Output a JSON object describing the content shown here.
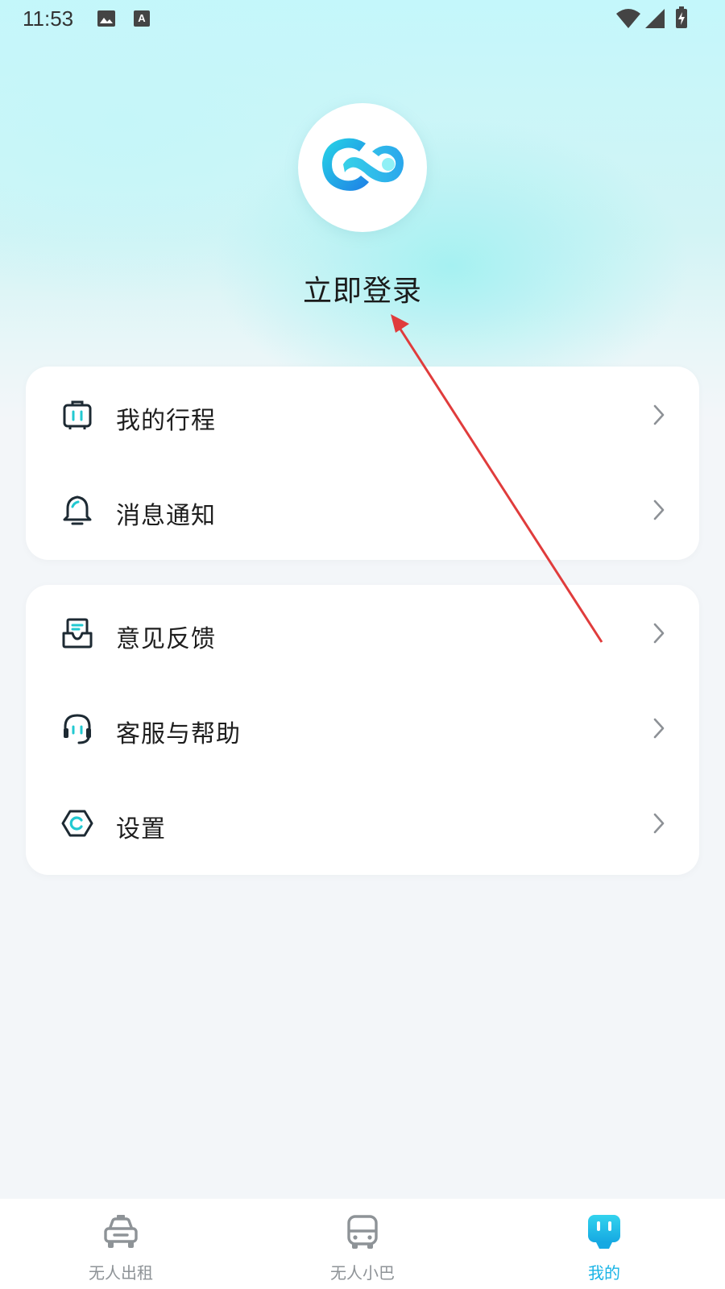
{
  "status_bar": {
    "time": "11:53",
    "left_icons": [
      "image-icon",
      "font-a-icon"
    ],
    "right_icons": [
      "wifi-icon",
      "signal-icon",
      "battery-charging-icon"
    ]
  },
  "profile": {
    "avatar_icon": "app-logo-icon",
    "login_label": "立即登录"
  },
  "menu_groups": [
    {
      "items": [
        {
          "icon": "luggage-icon",
          "label": "我的行程"
        },
        {
          "icon": "bell-icon",
          "label": "消息通知"
        }
      ]
    },
    {
      "items": [
        {
          "icon": "feedback-icon",
          "label": "意见反馈"
        },
        {
          "icon": "headset-icon",
          "label": "客服与帮助"
        },
        {
          "icon": "settings-hex-icon",
          "label": "设置"
        }
      ]
    }
  ],
  "bottom_nav": [
    {
      "icon": "taxi-icon",
      "label": "无人出租",
      "active": false
    },
    {
      "icon": "bus-icon",
      "label": "无人小巴",
      "active": false
    },
    {
      "icon": "robot-icon",
      "label": "我的",
      "active": true
    }
  ],
  "colors": {
    "accent": "#19b4e6",
    "annotation_arrow": "#e03c3c",
    "icon_dark": "#1d2a33",
    "icon_teal": "#22c9d1"
  }
}
